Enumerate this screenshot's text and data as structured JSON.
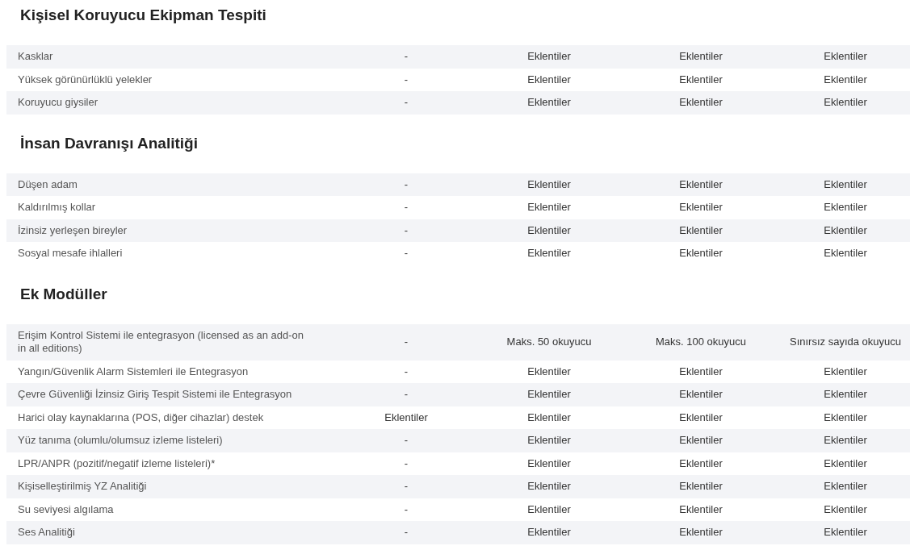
{
  "sections": [
    {
      "title": "Kişisel Koruyucu Ekipman Tespiti",
      "rows": [
        {
          "feature": "Kasklar",
          "cells": [
            "-",
            "Eklentiler",
            "Eklentiler",
            "Eklentiler"
          ]
        },
        {
          "feature": "Yüksek görünürlüklü yelekler",
          "cells": [
            "-",
            "Eklentiler",
            "Eklentiler",
            "Eklentiler"
          ]
        },
        {
          "feature": "Koruyucu giysiler",
          "cells": [
            "-",
            "Eklentiler",
            "Eklentiler",
            "Eklentiler"
          ]
        }
      ]
    },
    {
      "title": "İnsan Davranışı Analitiği",
      "rows": [
        {
          "feature": "Düşen adam",
          "cells": [
            "-",
            "Eklentiler",
            "Eklentiler",
            "Eklentiler"
          ]
        },
        {
          "feature": "Kaldırılmış kollar",
          "cells": [
            "-",
            "Eklentiler",
            "Eklentiler",
            "Eklentiler"
          ]
        },
        {
          "feature": "İzinsiz yerleşen bireyler",
          "cells": [
            "-",
            "Eklentiler",
            "Eklentiler",
            "Eklentiler"
          ]
        },
        {
          "feature": "Sosyal mesafe ihlalleri",
          "cells": [
            "-",
            "Eklentiler",
            "Eklentiler",
            "Eklentiler"
          ]
        }
      ]
    },
    {
      "title": "Ek Modüller",
      "rows": [
        {
          "feature": "Erişim Kontrol Sistemi ile entegrasyon (licensed as an add-on in all editions)",
          "cells": [
            "-",
            "Maks. 50 okuyucu",
            "Maks. 100 okuyucu",
            "Sınırsız sayıda okuyucu"
          ]
        },
        {
          "feature": "Yangın/Güvenlik Alarm Sistemleri ile Entegrasyon",
          "cells": [
            "-",
            "Eklentiler",
            "Eklentiler",
            "Eklentiler"
          ]
        },
        {
          "feature": "Çevre Güvenliği İzinsiz Giriş Tespit Sistemi ile Entegrasyon",
          "cells": [
            "-",
            "Eklentiler",
            "Eklentiler",
            "Eklentiler"
          ]
        },
        {
          "feature": "Harici olay kaynaklarına (POS, diğer cihazlar) destek",
          "cells": [
            "Eklentiler",
            "Eklentiler",
            "Eklentiler",
            "Eklentiler"
          ]
        },
        {
          "feature": "Yüz tanıma (olumlu/olumsuz izleme listeleri)",
          "cells": [
            "-",
            "Eklentiler",
            "Eklentiler",
            "Eklentiler"
          ]
        },
        {
          "feature": "LPR/ANPR (pozitif/negatif izleme listeleri)*",
          "cells": [
            "-",
            "Eklentiler",
            "Eklentiler",
            "Eklentiler"
          ]
        },
        {
          "feature": "Kişiselleştirilmiş YZ Analitiği",
          "cells": [
            "-",
            "Eklentiler",
            "Eklentiler",
            "Eklentiler"
          ]
        },
        {
          "feature": "Su seviyesi algılama",
          "cells": [
            "-",
            "Eklentiler",
            "Eklentiler",
            "Eklentiler"
          ]
        },
        {
          "feature": "Ses Analitiği",
          "cells": [
            "-",
            "Eklentiler",
            "Eklentiler",
            "Eklentiler"
          ]
        }
      ]
    }
  ]
}
